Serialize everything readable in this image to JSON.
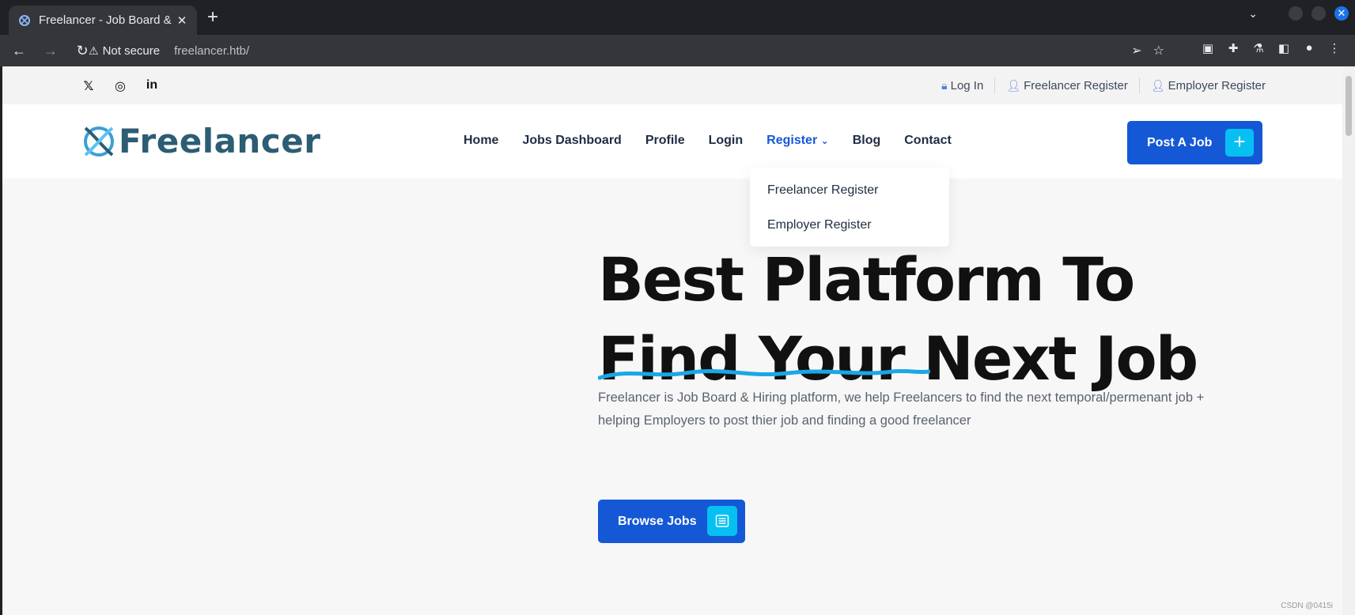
{
  "browser": {
    "tab_title": "Freelancer - Job Board & Hiring platform",
    "tab_close": "✕",
    "new_tab": "+",
    "tab_search": "⌄",
    "security_label": "Not secure",
    "url": "freelancer.htb/"
  },
  "topbar": {
    "social": [
      "twitter-icon",
      "instagram-icon",
      "linkedin-icon"
    ],
    "login": "Log In",
    "freelancer_register": "Freelancer Register",
    "employer_register": "Employer Register"
  },
  "nav": {
    "logo": "Freelancer",
    "items": [
      "Home",
      "Jobs Dashboard",
      "Profile",
      "Login",
      "Register",
      "Blog",
      "Contact"
    ],
    "register_caret": "⌄",
    "post_job": "Post A Job"
  },
  "dropdown": {
    "items": [
      "Freelancer Register",
      "Employer Register"
    ]
  },
  "hero": {
    "title_line1": "Best Platform To",
    "title_line2": "Find Your Next Job",
    "description": "Freelancer is Job Board & Hiring platform, we help Freelancers to find the next temporal/permenant job + helping Employers to post thier job and finding a good freelancer",
    "browse_button": "Browse Jobs"
  },
  "watermark": "CSDN @0415i",
  "colors": {
    "accent": "#1558d6",
    "accent_secondary": "#07c0f2",
    "logo": "#2c5d74"
  }
}
